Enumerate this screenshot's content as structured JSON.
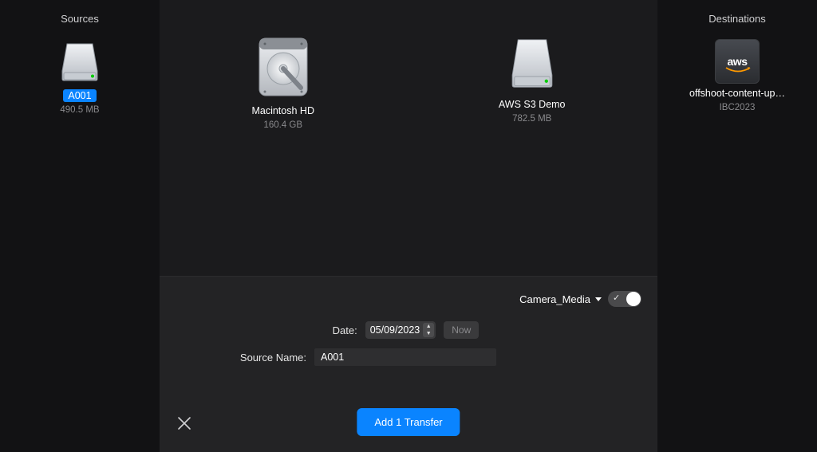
{
  "sources": {
    "header": "Sources",
    "items": [
      {
        "label": "A001",
        "sub": "490.5 MB",
        "selected": true,
        "icon": "hdd-removable"
      }
    ]
  },
  "center_drives": [
    {
      "label": "Macintosh HD",
      "sub": "160.4 GB",
      "icon": "hdd-internal"
    },
    {
      "label": "AWS S3 Demo",
      "sub": "782.5 MB",
      "icon": "hdd-removable"
    }
  ],
  "destinations": {
    "header": "Destinations",
    "items": [
      {
        "label": "offshoot-content-up…",
        "sub": "IBC2023",
        "icon": "aws",
        "aws_text": "aws"
      }
    ]
  },
  "preset": {
    "name": "Camera_Media",
    "toggle_on": true
  },
  "form": {
    "date_label": "Date:",
    "date_value": "05/09/2023",
    "now_label": "Now",
    "source_name_label": "Source Name:",
    "source_name_value": "A001"
  },
  "add_button_label": "Add 1 Transfer"
}
